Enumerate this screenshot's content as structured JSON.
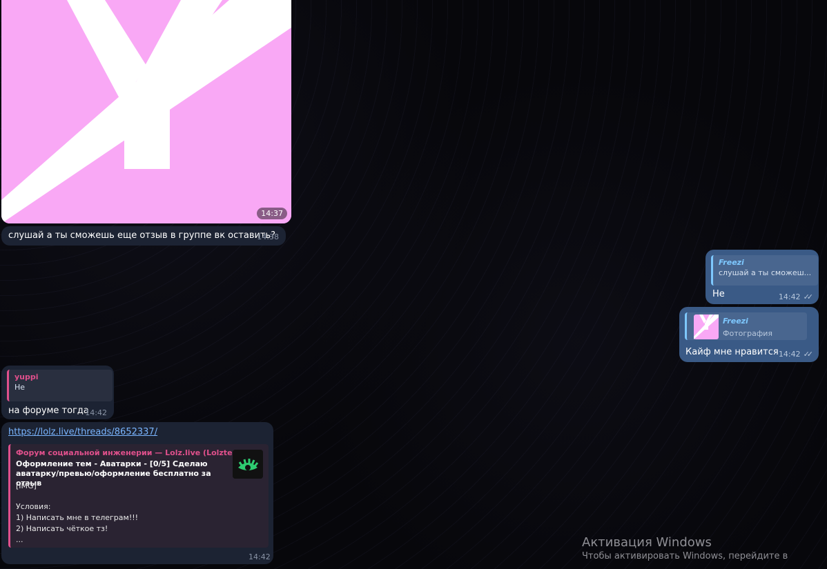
{
  "messages": {
    "photo_time": "14:37",
    "m1": {
      "text": "слушай а ты сможешь еще отзыв в группе вк оставить?",
      "time": "14:38"
    },
    "out1": {
      "reply_name": "Freezi",
      "reply_text": "слушай а ты сможеш...",
      "text": "Не",
      "time": "14:42"
    },
    "out2": {
      "reply_name": "Freezi",
      "reply_text": "Фотография",
      "text": "Кайф мне нравится",
      "time": "14:42"
    },
    "in2": {
      "reply_name": "yuppi",
      "reply_text": "Не",
      "text": "на форуме тогда",
      "time": "14:42"
    },
    "in3": {
      "link": "https://lolz.live/threads/8652337/",
      "site": "Форум социальной инженерии —  Lolz.live (Lolzteam)",
      "title": "Оформление тем - Аватарки - [0/5] Сделаю аватарку/превью/оформление бесплатно за отзыв",
      "l1": "[IMG]",
      "l2": "Условия:",
      "l3": "1) Написать мне в телеграм!!!",
      "l4": "2) Написать чёткое тз!",
      "l5": "...",
      "time": "14:42"
    }
  },
  "watermark": {
    "title": "Активация Windows",
    "subtitle": "Чтобы активировать Windows, перейдите в"
  },
  "colors": {
    "accent_pink": "#e0508c",
    "outgoing": "#3a5a86",
    "incoming": "#1c2333",
    "photo_bg": "#f9a8f5"
  }
}
